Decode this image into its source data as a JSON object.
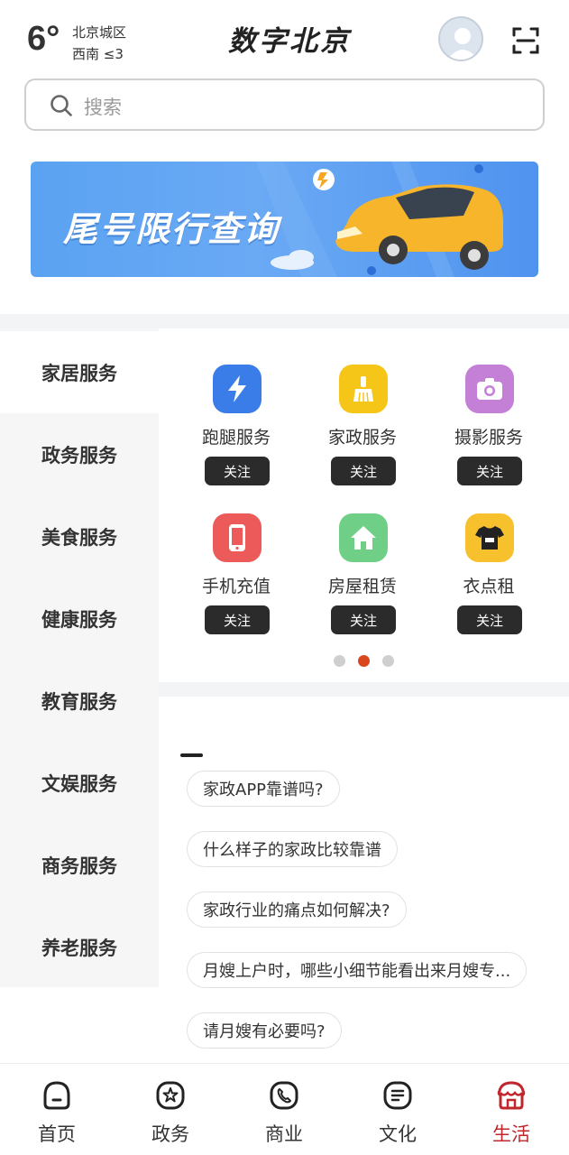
{
  "header": {
    "temperature": "6°",
    "location": "北京城区",
    "wind": "西南  ≤3",
    "logo": "数字北京"
  },
  "search": {
    "placeholder": "搜索"
  },
  "banner": {
    "title": "尾号限行查询"
  },
  "categories": [
    {
      "label": "家居服务"
    },
    {
      "label": "政务服务"
    },
    {
      "label": "美食服务"
    },
    {
      "label": "健康服务"
    },
    {
      "label": "教育服务"
    },
    {
      "label": "文娱服务"
    },
    {
      "label": "商务服务"
    },
    {
      "label": "养老服务"
    }
  ],
  "services": [
    {
      "label": "跑腿服务",
      "button": "关注",
      "icon": "lightning-icon",
      "color": "#3b7de8"
    },
    {
      "label": "家政服务",
      "button": "关注",
      "icon": "broom-icon",
      "color": "#f5c518"
    },
    {
      "label": "摄影服务",
      "button": "关注",
      "icon": "camera-icon",
      "color": "#c47fd6"
    },
    {
      "label": "手机充值",
      "button": "关注",
      "icon": "phone-icon",
      "color": "#ec5a5a"
    },
    {
      "label": "房屋租赁",
      "button": "关注",
      "icon": "house-icon",
      "color": "#6fcf86"
    },
    {
      "label": "衣点租",
      "button": "关注",
      "icon": "tshirt-icon",
      "color": "#f7c12e"
    }
  ],
  "pager": {
    "pages": 3,
    "current": 2
  },
  "questions": [
    {
      "text": "家政APP靠谱吗?"
    },
    {
      "text": "什么样子的家政比较靠谱"
    },
    {
      "text": "家政行业的痛点如何解决?"
    },
    {
      "text": "月嫂上户时，哪些小细节能看出来月嫂专..."
    },
    {
      "text": "请月嫂有必要吗?"
    }
  ],
  "nav": [
    {
      "label": "首页",
      "icon": "home-icon"
    },
    {
      "label": "政务",
      "icon": "government-icon"
    },
    {
      "label": "商业",
      "icon": "business-icon"
    },
    {
      "label": "文化",
      "icon": "culture-icon"
    },
    {
      "label": "生活",
      "icon": "life-icon"
    }
  ],
  "colors": {
    "accent": "#c0272d",
    "pager_active": "#d9471e"
  }
}
